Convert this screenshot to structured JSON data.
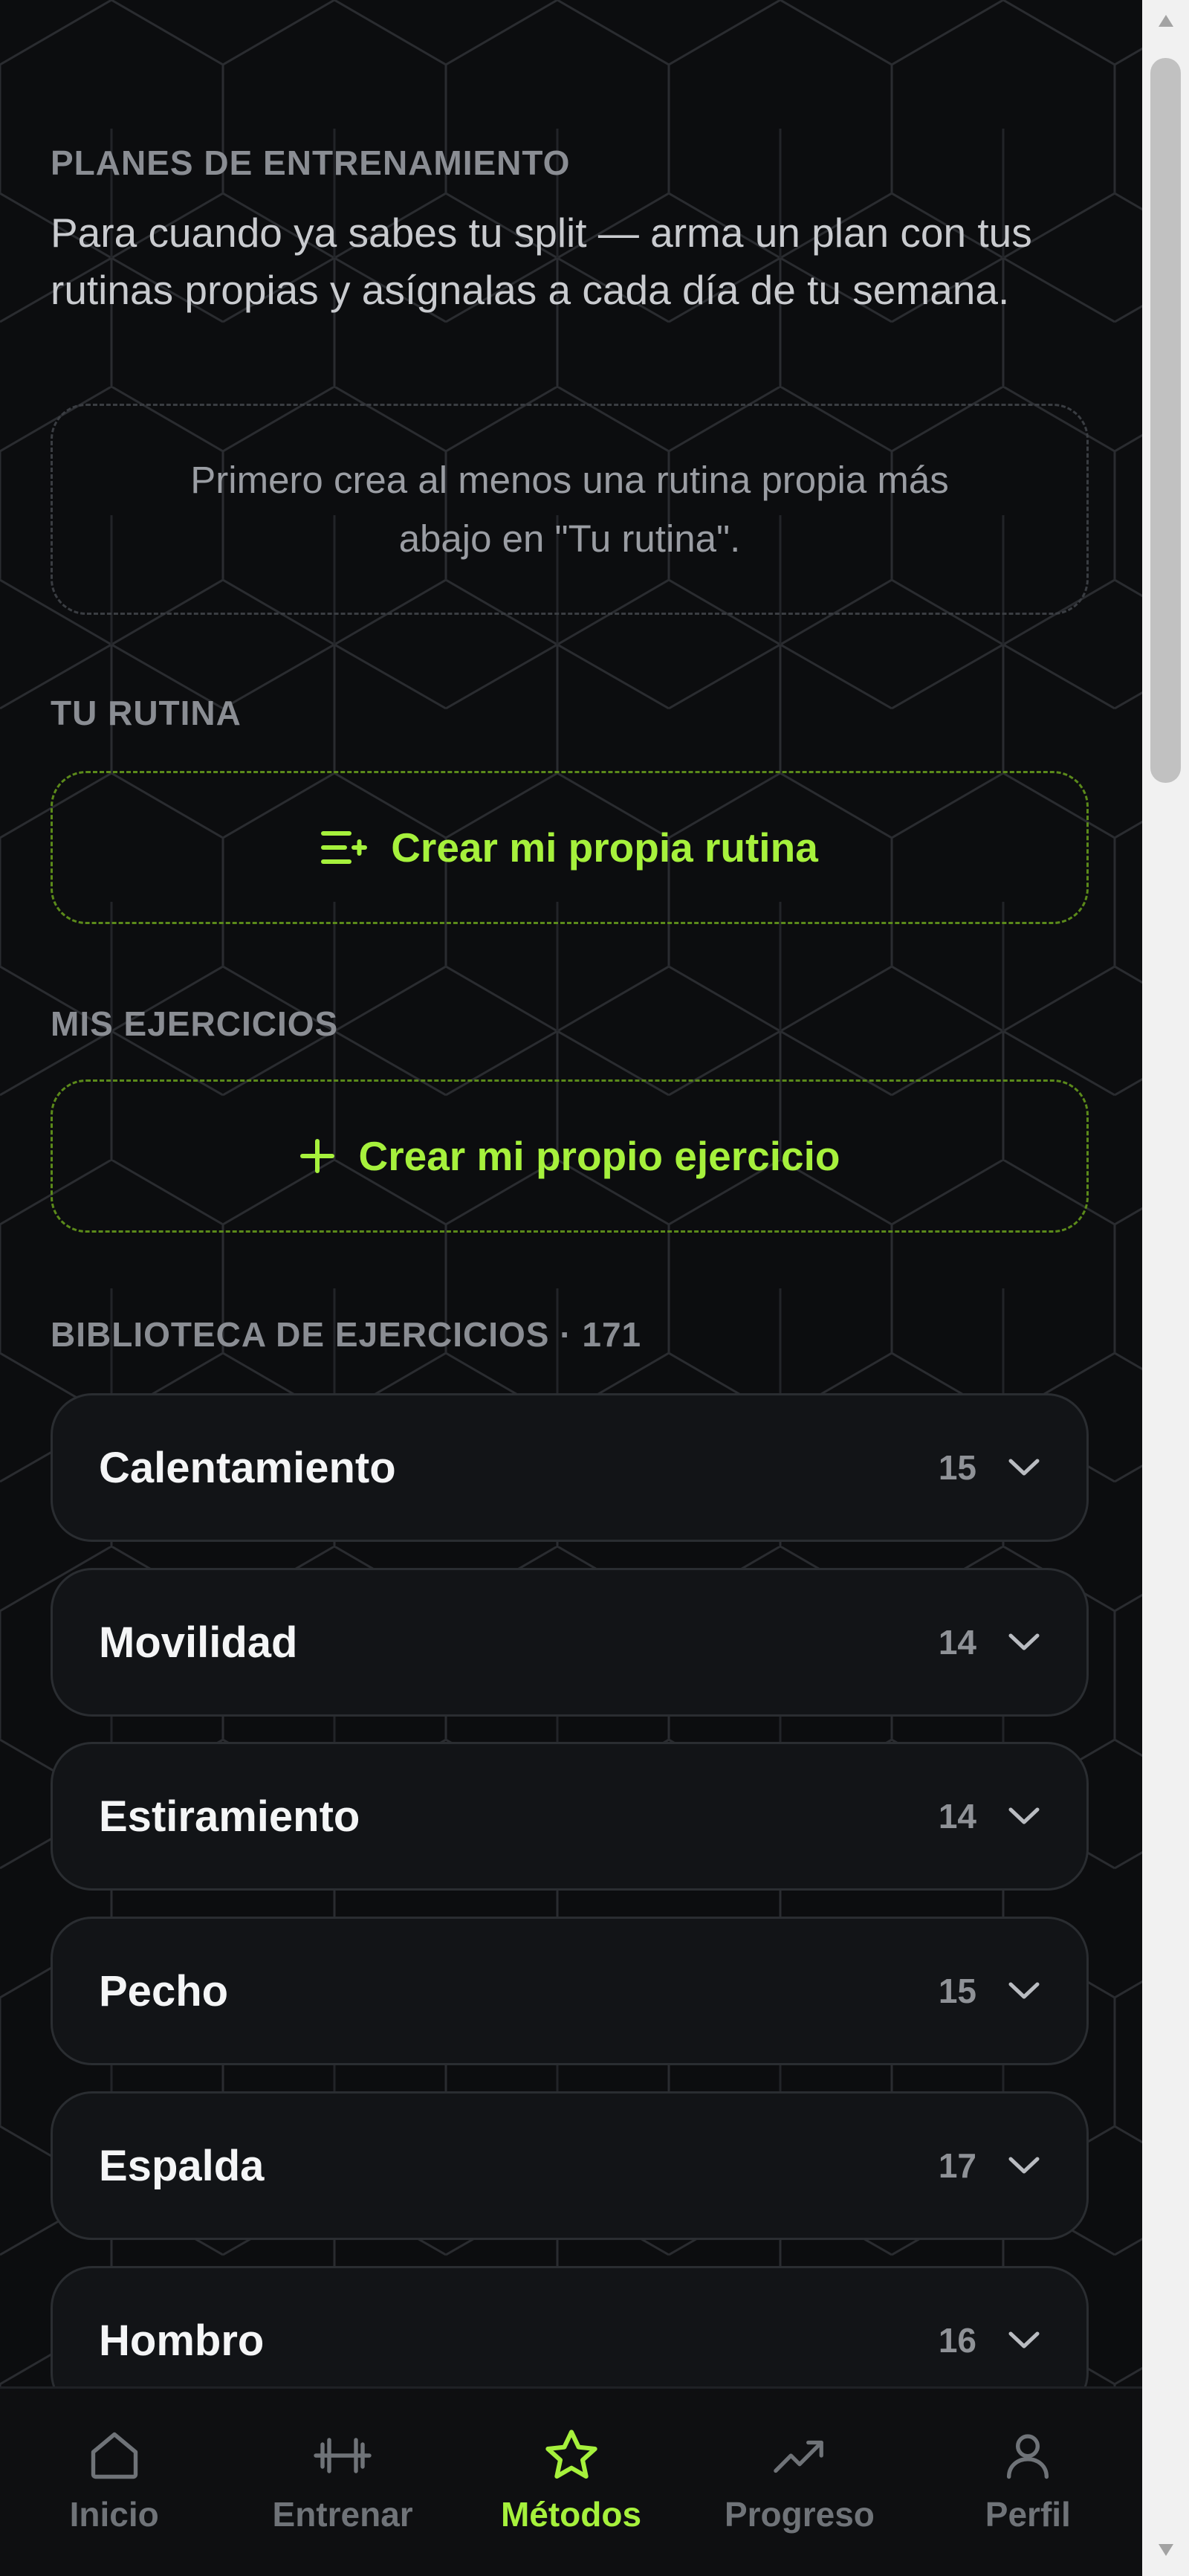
{
  "plans": {
    "heading": "PLANES DE ENTRENAMIENTO",
    "description": "Para cuando ya sabes tu split — arma un plan con tus rutinas propias y asígnalas a cada día de tu semana.",
    "empty_note": "Primero crea al menos una rutina propia más abajo en \"Tu rutina\"."
  },
  "routine": {
    "heading": "TU RUTINA",
    "create_label": "Crear mi propia rutina",
    "icon": "list-add-icon"
  },
  "exercises": {
    "heading": "MIS EJERCICIOS",
    "create_label": "Crear mi propio ejercicio",
    "icon": "plus-icon"
  },
  "library": {
    "heading": "BIBLIOTECA DE EJERCICIOS · 171",
    "categories": [
      {
        "name": "Calentamiento",
        "count": "15"
      },
      {
        "name": "Movilidad",
        "count": "14"
      },
      {
        "name": "Estiramiento",
        "count": "14"
      },
      {
        "name": "Pecho",
        "count": "15"
      },
      {
        "name": "Espalda",
        "count": "17"
      },
      {
        "name": "Hombro",
        "count": "16"
      }
    ]
  },
  "nav": {
    "items": [
      {
        "label": "Inicio",
        "icon": "home-icon"
      },
      {
        "label": "Entrenar",
        "icon": "dumbbell-icon"
      },
      {
        "label": "Métodos",
        "icon": "star-icon",
        "active": true
      },
      {
        "label": "Progreso",
        "icon": "trending-up-icon"
      },
      {
        "label": "Perfil",
        "icon": "user-icon"
      }
    ]
  },
  "colors": {
    "accent": "#a6f13c",
    "background": "#0c0d0f",
    "card": "#121417",
    "muted_text": "#8a8d93"
  }
}
